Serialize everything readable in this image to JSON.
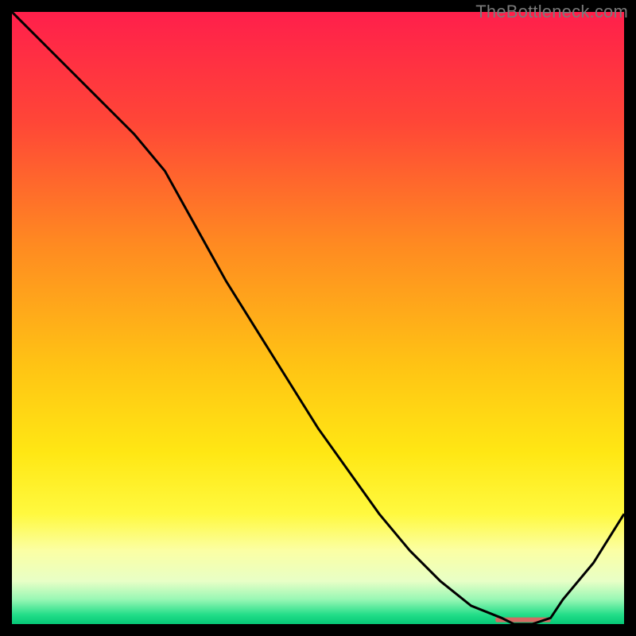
{
  "watermark": "TheBottleneck.com",
  "chart_data": {
    "type": "line",
    "title": "",
    "xlabel": "",
    "ylabel": "",
    "xlim": [
      0,
      100
    ],
    "ylim": [
      0,
      100
    ],
    "grid": false,
    "x": [
      0,
      5,
      10,
      15,
      20,
      25,
      30,
      35,
      40,
      45,
      50,
      55,
      60,
      65,
      70,
      75,
      80,
      82,
      85,
      88,
      90,
      95,
      100
    ],
    "values": [
      100,
      95,
      90,
      85,
      80,
      74,
      65,
      56,
      48,
      40,
      32,
      25,
      18,
      12,
      7,
      3,
      1,
      0,
      0,
      1,
      4,
      10,
      18
    ],
    "minimum_band": {
      "x_start": 79,
      "x_end": 88,
      "y": 0.7
    }
  },
  "gradient": {
    "stops": [
      {
        "offset": 0.0,
        "color": "#ff1f4b"
      },
      {
        "offset": 0.18,
        "color": "#ff4637"
      },
      {
        "offset": 0.38,
        "color": "#ff8a21"
      },
      {
        "offset": 0.58,
        "color": "#ffc414"
      },
      {
        "offset": 0.72,
        "color": "#ffe714"
      },
      {
        "offset": 0.82,
        "color": "#fff93f"
      },
      {
        "offset": 0.88,
        "color": "#fbffa4"
      },
      {
        "offset": 0.93,
        "color": "#e8ffc6"
      },
      {
        "offset": 0.96,
        "color": "#97f7b4"
      },
      {
        "offset": 0.985,
        "color": "#22dd88"
      },
      {
        "offset": 1.0,
        "color": "#05c877"
      }
    ]
  },
  "line_color": "#000000",
  "min_band_color": "#d46a63"
}
